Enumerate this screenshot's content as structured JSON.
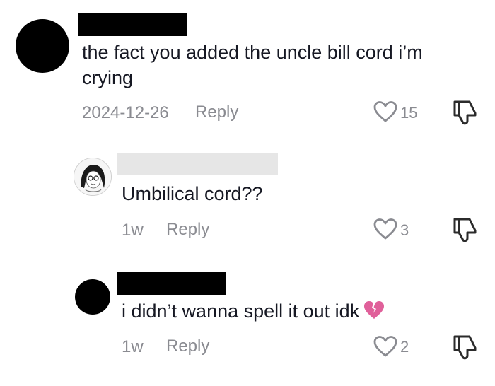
{
  "comments": [
    {
      "text": "the fact you added the uncle bill cord i’m crying",
      "date": "2024-12-26",
      "reply_label": "Reply",
      "likes": "15",
      "avatar_icon": "black-circle-avatar",
      "emoji": ""
    },
    {
      "text": "Umbilical cord??",
      "date": "1w",
      "reply_label": "Reply",
      "likes": "3",
      "avatar_icon": "anime-girl-avatar",
      "emoji": ""
    },
    {
      "text": "i didn’t wanna spell it out idk",
      "date": "1w",
      "reply_label": "Reply",
      "likes": "2",
      "avatar_icon": "black-circle-avatar",
      "emoji": "broken-heart-icon"
    }
  ],
  "colors": {
    "text": "#161823",
    "meta": "#8a8b91",
    "broken_heart": "#e0609a",
    "redaction_black": "#000000",
    "redaction_gray": "#e6e6e6"
  }
}
